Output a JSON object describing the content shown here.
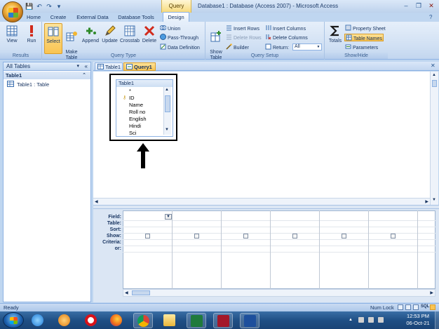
{
  "window": {
    "title": "Database1 : Database (Access 2007) - Microsoft Access",
    "context_tab": "Query Tools",
    "controls": {
      "minimize": "–",
      "restore": "❐",
      "close": "✕"
    }
  },
  "quick_access": {
    "save": "💾",
    "undo": "↶",
    "redo": "↷",
    "more": "▾"
  },
  "tabs": [
    "Home",
    "Create",
    "External Data",
    "Database Tools",
    "Design"
  ],
  "ribbon": {
    "results": {
      "label": "Results",
      "view": "View",
      "run": "Run"
    },
    "query_type": {
      "label": "Query Type",
      "select": "Select",
      "make_table": "Make\nTable",
      "append": "Append",
      "update": "Update",
      "crosstab": "Crosstab",
      "delete": "Delete",
      "union": "Union",
      "pass_through": "Pass-Through",
      "data_definition": "Data Definition"
    },
    "query_setup": {
      "label": "Query Setup",
      "show_table": "Show\nTable",
      "insert_rows": "Insert Rows",
      "delete_rows": "Delete Rows",
      "builder": "Builder",
      "insert_columns": "Insert Columns",
      "delete_columns": "Delete Columns",
      "return_label": "Return:",
      "return_value": "All"
    },
    "show_hide": {
      "label": "Show/Hide",
      "totals": "Totals",
      "property_sheet": "Property Sheet",
      "table_names": "Table Names",
      "parameters": "Parameters"
    }
  },
  "nav": {
    "header": "All Tables",
    "group": "Table1",
    "item": "Table1 : Table"
  },
  "doc_tabs": [
    "Table1",
    "Query1"
  ],
  "table_box": {
    "title": "Table1",
    "fields": [
      "*",
      "ID",
      "Name",
      "Roll no",
      "English",
      "Hindi",
      "Sci"
    ]
  },
  "grid": {
    "row_labels": [
      "Field:",
      "Table:",
      "Sort:",
      "Show:",
      "Criteria:",
      "or:"
    ]
  },
  "status": {
    "left": "Ready",
    "num_lock": "Num Lock",
    "sql": "SQL"
  },
  "clock": {
    "time": "12:53 PM",
    "date": "06-Oct-21"
  },
  "colors": {
    "ribbon": "#cfdff3",
    "accent": "#f9c452",
    "taskbar": "#1f4f85"
  }
}
